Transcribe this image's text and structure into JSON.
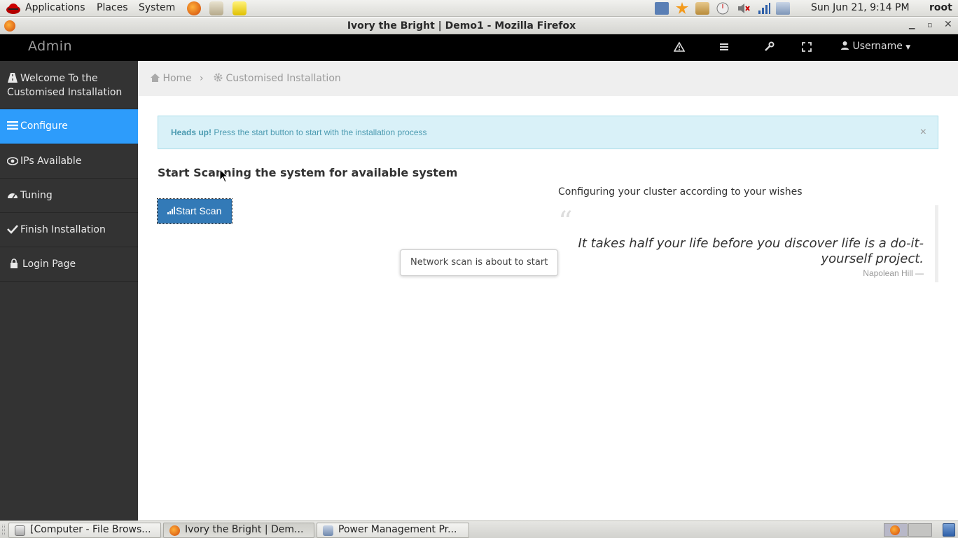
{
  "panel": {
    "menus": [
      "Applications",
      "Places",
      "System"
    ],
    "clock": "Sun Jun 21,  9:14 PM",
    "user": "root"
  },
  "window": {
    "title": "Ivory the Bright | Demo1 - Mozilla Firefox"
  },
  "navbar": {
    "brand": "Admin",
    "user_menu": "Username"
  },
  "sidebar": {
    "items": [
      {
        "label_line1": "Welcome To the",
        "label_line2": "Customised Installation",
        "icon": "road-icon"
      },
      {
        "label": "Configure",
        "icon": "tasks-icon",
        "active": true
      },
      {
        "label": "IPs Available",
        "icon": "eye-icon"
      },
      {
        "label": "Tuning",
        "icon": "dashboard-icon"
      },
      {
        "label": "Finish Installation",
        "icon": "check-icon"
      },
      {
        "label": "Login Page",
        "icon": "lock-icon"
      }
    ]
  },
  "breadcrumb": {
    "home": "Home",
    "current": "Customised Installation"
  },
  "alert": {
    "strong": "Heads up!",
    "text": "Press the start button to start with the installation process",
    "close": "×"
  },
  "scan": {
    "heading": "Start Scanning the system for available system",
    "button": "Start Scan",
    "tooltip": "Network scan is about to start"
  },
  "cluster": {
    "caption": "Configuring your cluster according to your wishes",
    "quote_line1": "It takes half your life before you discover life is a do-it-",
    "quote_line2": "yourself project.",
    "author": "Napolean Hill —"
  },
  "taskbar": {
    "tasks": [
      "[Computer - File Brows...",
      "Ivory the Bright | Dem...",
      "Power Management Pr..."
    ]
  },
  "colors": {
    "accent": "#2d9cfb",
    "sidebar": "#333333",
    "navbar": "#000000",
    "button": "#337ab7"
  }
}
